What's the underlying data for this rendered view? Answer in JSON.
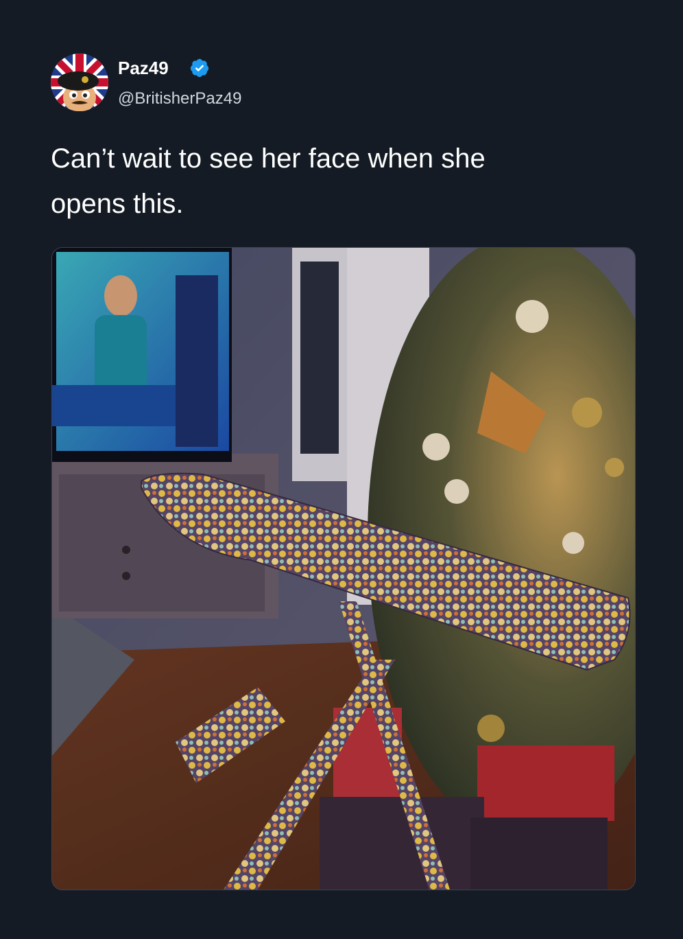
{
  "tweet": {
    "author": {
      "display_name": "Paz49",
      "handle": "@BritisherPaz49",
      "verified": true,
      "avatar_icon": "cartoon-soldier-avatar-icon",
      "verified_icon": "verified-badge-icon",
      "verified_color": "#1d9bf0"
    },
    "text": "Can’t wait to see her face when she\nopens this.",
    "media": {
      "kind": "photo",
      "icon": "photo"
    }
  },
  "theme": {
    "background": "#151b24",
    "text_primary": "#ffffff",
    "text_secondary": "#d1d7de"
  }
}
